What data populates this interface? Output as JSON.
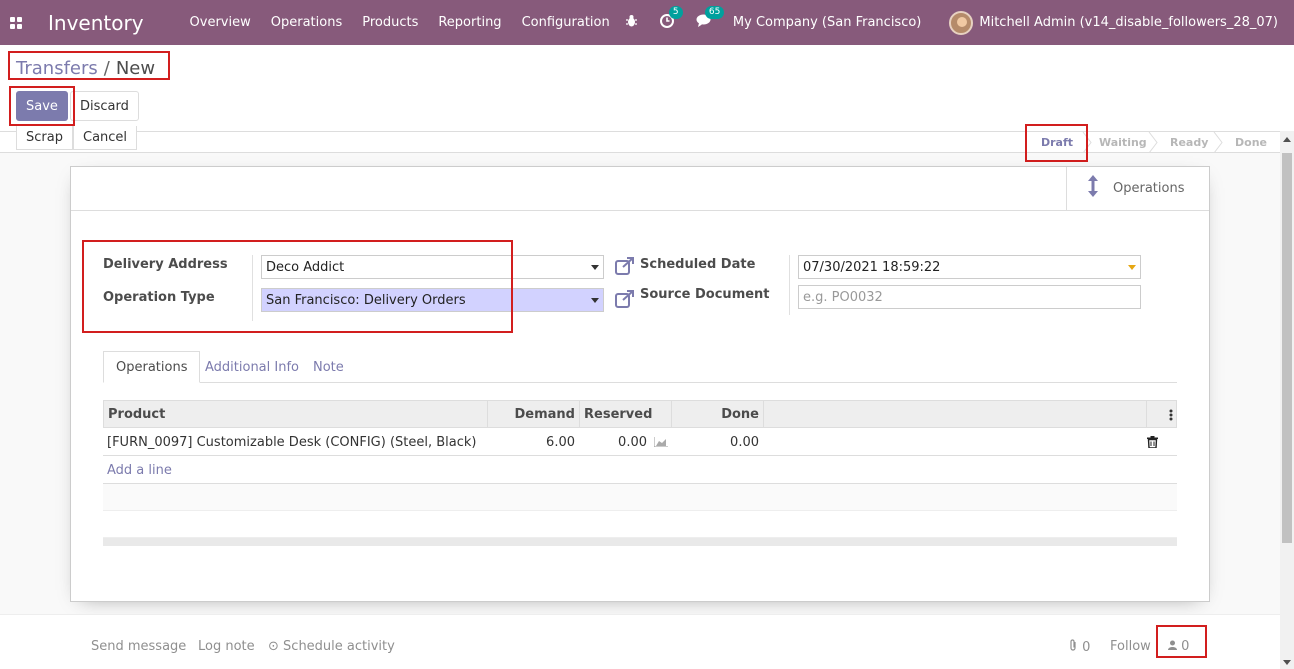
{
  "navbar": {
    "app_name": "Inventory",
    "menu": [
      "Overview",
      "Operations",
      "Products",
      "Reporting",
      "Configuration"
    ],
    "activity_count": "5",
    "message_count": "65",
    "company": "My Company (San Francisco)",
    "user": "Mitchell Admin (v14_disable_followers_28_07)",
    "color": "#875a7b"
  },
  "breadcrumb": {
    "parent": "Transfers",
    "separator": "/",
    "current": "New"
  },
  "buttons": {
    "save": "Save",
    "discard": "Discard",
    "scrap": "Scrap",
    "cancel": "Cancel"
  },
  "statusbar": {
    "stages": [
      "Draft",
      "Waiting",
      "Ready",
      "Done"
    ],
    "active": "Draft"
  },
  "smart_button": {
    "label": "Operations"
  },
  "form": {
    "delivery_address_label": "Delivery Address",
    "delivery_address_value": "Deco Addict",
    "operation_type_label": "Operation Type",
    "operation_type_value": "San Francisco: Delivery Orders",
    "scheduled_date_label": "Scheduled Date",
    "scheduled_date_value": "07/30/2021 18:59:22",
    "source_document_label": "Source Document",
    "source_document_placeholder": "e.g. PO0032"
  },
  "tabs": [
    "Operations",
    "Additional Info",
    "Note"
  ],
  "table": {
    "columns": [
      "Product",
      "Demand",
      "Reserved",
      "Done"
    ],
    "rows": [
      {
        "product": "[FURN_0097] Customizable Desk (CONFIG) (Steel, Black)",
        "demand": "6.00",
        "reserved": "0.00",
        "done": "0.00"
      }
    ],
    "add_line": "Add a line"
  },
  "chatter": {
    "send_message": "Send message",
    "log_note": "Log note",
    "schedule_activity": "Schedule activity",
    "attachments": "0",
    "follow": "Follow",
    "followers": "0"
  },
  "accent_color": "#7c7bad",
  "highlight_color": "#d21e1e"
}
